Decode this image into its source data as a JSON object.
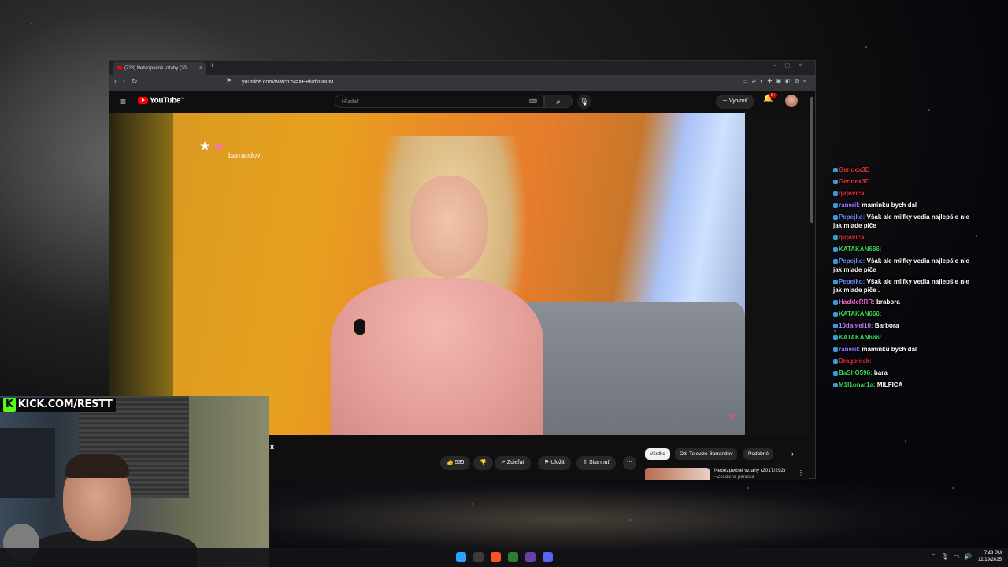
{
  "browser": {
    "tab_title": "(723) Nebezpečné vztahy (20",
    "url": "youtube.com/watch?v=XEBiwfxUuuM",
    "tab_close": "×",
    "new_tab": "+"
  },
  "youtube": {
    "logo": "YouTube",
    "region": "SK",
    "search_placeholder": "Hľadať",
    "create_label": "Vytvoriť",
    "notification_count": "9+",
    "video_title_fragment": "x",
    "like_count": "535",
    "share_label": "Zdieľať",
    "save_label": "Uložiť",
    "download_label": "Stiahnuť",
    "chips": [
      "Všetko",
      "Od: Televize Barrandov",
      "Podobné"
    ],
    "recommended": {
      "title": "Nebezpečné vztahy (2017/292)",
      "subtitle": "- Zoudičná panička"
    }
  },
  "video": {
    "channel_logo_top": "tv",
    "channel_logo_bottom": "barrandov"
  },
  "overlay": {
    "kick_handle": "KICK.COM/RESTT"
  },
  "chat": [
    {
      "user": "Gendex3D",
      "color": "#e0323c",
      "text": ""
    },
    {
      "user": "Gendex3D",
      "color": "#e0323c",
      "text": ""
    },
    {
      "user": "qiqovica:",
      "color": "#e0323c",
      "text": ""
    },
    {
      "user": "raneril:",
      "color": "#9b7bff",
      "text": "maminku bych dal"
    },
    {
      "user": "Pepejko:",
      "color": "#6b8cff",
      "text": "Však ale milfky vedia najlepšie nie jak mlade piče"
    },
    {
      "user": "qiqovica:",
      "color": "#e0323c",
      "text": ""
    },
    {
      "user": "KATAKAN666:",
      "color": "#3dd65c",
      "text": ""
    },
    {
      "user": "Pepejko:",
      "color": "#6b8cff",
      "text": "Však ale milfky vedia najlepšie nie jak mlade piče"
    },
    {
      "user": "Pepejko:",
      "color": "#6b8cff",
      "text": "Však ale milfky vedia najlepšie nie jak mlade piče ."
    },
    {
      "user": "HackleRRR:",
      "color": "#f26bd1",
      "text": "brabora"
    },
    {
      "user": "KATAKAN666:",
      "color": "#3dd65c",
      "text": ""
    },
    {
      "user": "10daniel10:",
      "color": "#c77dff",
      "text": "Barbora"
    },
    {
      "user": "KATAKAN666:",
      "color": "#3dd65c",
      "text": ""
    },
    {
      "user": "raneril:",
      "color": "#9b7bff",
      "text": "maminku bych dal"
    },
    {
      "user": "Dragonisk:",
      "color": "#e0323c",
      "text": ""
    },
    {
      "user": "BaShO596:",
      "color": "#3dd65c",
      "text": "bara"
    },
    {
      "user": "M1l1onar1a:",
      "color": "#3dd65c",
      "text": "MILFICA"
    }
  ],
  "clock": {
    "time": "7:49 PM",
    "date": "12/19/2025"
  },
  "colors": {
    "youtube_red": "#ff0000",
    "kick_green": "#53fc18",
    "yt_bg": "#0f0f0f"
  }
}
